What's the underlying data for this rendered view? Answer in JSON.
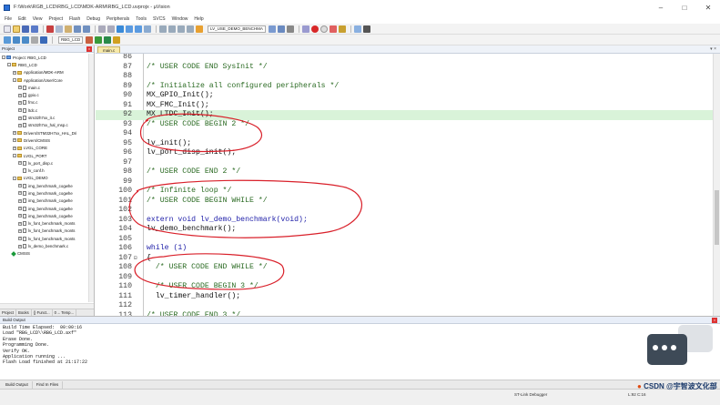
{
  "window": {
    "title": "F:\\Work\\RGB_LCD\\RBG_LCD\\MDK-ARM\\RBG_LCD.uvprojx - µVision",
    "controls": [
      "–",
      "□",
      "✕"
    ]
  },
  "menu": [
    "File",
    "Edit",
    "View",
    "Project",
    "Flash",
    "Debug",
    "Peripherals",
    "Tools",
    "SVCS",
    "Window",
    "Help"
  ],
  "toolbar": {
    "find_text": "LV_USE_DEMO_BENCHMA",
    "target_name": "RBG_LCD"
  },
  "project_panel": {
    "title": "Project",
    "tree": [
      {
        "label": "Project: RBG_LCD",
        "level": 0,
        "type": "proj",
        "exp": "-"
      },
      {
        "label": "RBG_LCD",
        "level": 1,
        "type": "folder",
        "exp": "-"
      },
      {
        "label": "Application/MDK-ARM",
        "level": 2,
        "type": "folder",
        "exp": "+"
      },
      {
        "label": "Application/User/Core",
        "level": 2,
        "type": "folder",
        "exp": "-"
      },
      {
        "label": "main.c",
        "level": 3,
        "type": "file",
        "exp": "+"
      },
      {
        "label": "gpio.c",
        "level": 3,
        "type": "file",
        "exp": "+"
      },
      {
        "label": "fmc.c",
        "level": 3,
        "type": "file",
        "exp": "+"
      },
      {
        "label": "ltdc.c",
        "level": 3,
        "type": "file",
        "exp": "+"
      },
      {
        "label": "stm32h7xx_it.c",
        "level": 3,
        "type": "file",
        "exp": "+"
      },
      {
        "label": "stm32h7xx_hal_msp.c",
        "level": 3,
        "type": "file",
        "exp": "+"
      },
      {
        "label": "Drivers/STM32H7xx_HAL_Dri",
        "level": 2,
        "type": "folder",
        "exp": "+"
      },
      {
        "label": "Drivers/CMSIS",
        "level": 2,
        "type": "folder",
        "exp": "+"
      },
      {
        "label": "LVGL_CORE",
        "level": 2,
        "type": "folder",
        "exp": "+"
      },
      {
        "label": "LVGL_PORT",
        "level": 2,
        "type": "folder",
        "exp": "-"
      },
      {
        "label": "lv_port_disp.c",
        "level": 3,
        "type": "file",
        "exp": "+"
      },
      {
        "label": "lv_conf.h",
        "level": 3,
        "type": "file",
        "exp": ""
      },
      {
        "label": "LVGL_DEMO",
        "level": 2,
        "type": "folder",
        "exp": "-"
      },
      {
        "label": "img_benchmark_cogwhe",
        "level": 3,
        "type": "file",
        "exp": "+"
      },
      {
        "label": "img_benchmark_cogwhe",
        "level": 3,
        "type": "file",
        "exp": "+"
      },
      {
        "label": "img_benchmark_cogwhe",
        "level": 3,
        "type": "file",
        "exp": "+"
      },
      {
        "label": "img_benchmark_cogwhe",
        "level": 3,
        "type": "file",
        "exp": "+"
      },
      {
        "label": "img_benchmark_cogwhe",
        "level": 3,
        "type": "file",
        "exp": "+"
      },
      {
        "label": "lv_font_benchmark_monts",
        "level": 3,
        "type": "file",
        "exp": "+"
      },
      {
        "label": "lv_font_benchmark_monts",
        "level": 3,
        "type": "file",
        "exp": "+"
      },
      {
        "label": "lv_font_benchmark_monts",
        "level": 3,
        "type": "file",
        "exp": "+"
      },
      {
        "label": "lv_demo_benchmark.c",
        "level": 3,
        "type": "file",
        "exp": "+"
      },
      {
        "label": "CMSIS",
        "level": 1,
        "type": "gem",
        "exp": ""
      }
    ],
    "tabs": [
      "Project",
      "Books",
      "{} Funct...",
      "0→ Temp..."
    ]
  },
  "editor": {
    "tab": "main.c",
    "lines": [
      {
        "n": "86",
        "fold": "",
        "text": "",
        "style": "plain"
      },
      {
        "n": "87",
        "fold": "",
        "text": "/* USER CODE END SysInit */",
        "style": "comment"
      },
      {
        "n": "88",
        "fold": "",
        "text": "",
        "style": "plain"
      },
      {
        "n": "89",
        "fold": "",
        "text": "/* Initialize all configured peripherals */",
        "style": "comment"
      },
      {
        "n": "90",
        "fold": "",
        "text": "MX_GPIO_Init();",
        "style": "plain"
      },
      {
        "n": "91",
        "fold": "",
        "text": "MX_FMC_Init();",
        "style": "plain"
      },
      {
        "n": "92",
        "fold": "",
        "text": "MX_LTDC_Init();",
        "style": "plain",
        "highlight": true
      },
      {
        "n": "93",
        "fold": "",
        "text": "/* USER CODE BEGIN 2 */",
        "style": "comment"
      },
      {
        "n": "94",
        "fold": "",
        "text": "",
        "style": "plain"
      },
      {
        "n": "95",
        "fold": "",
        "text": "lv_init();",
        "style": "plain"
      },
      {
        "n": "96",
        "fold": "",
        "text": "lv_port_disp_init();",
        "style": "plain"
      },
      {
        "n": "97",
        "fold": "",
        "text": "",
        "style": "plain"
      },
      {
        "n": "98",
        "fold": "",
        "text": "/* USER CODE END 2 */",
        "style": "comment"
      },
      {
        "n": "99",
        "fold": "",
        "text": "",
        "style": "plain"
      },
      {
        "n": "100",
        "fold": "",
        "text": "/* Infinite loop */",
        "style": "comment"
      },
      {
        "n": "101",
        "fold": "",
        "text": "/* USER CODE BEGIN WHILE */",
        "style": "comment"
      },
      {
        "n": "102",
        "fold": "",
        "text": "",
        "style": "plain"
      },
      {
        "n": "103",
        "fold": "",
        "text": "extern void lv_demo_benchmark(void);",
        "style": "keyword"
      },
      {
        "n": "104",
        "fold": "",
        "text": "lv_demo_benchmark();",
        "style": "plain"
      },
      {
        "n": "105",
        "fold": "",
        "text": "",
        "style": "plain"
      },
      {
        "n": "106",
        "fold": "",
        "text": "while (1)",
        "style": "keyword"
      },
      {
        "n": "107",
        "fold": "⊟",
        "text": "{",
        "style": "plain"
      },
      {
        "n": "108",
        "fold": "",
        "text": "  /* USER CODE END WHILE */",
        "style": "comment"
      },
      {
        "n": "109",
        "fold": "",
        "text": "",
        "style": "plain"
      },
      {
        "n": "110",
        "fold": "",
        "text": "  /* USER CODE BEGIN 3 */",
        "style": "comment"
      },
      {
        "n": "111",
        "fold": "",
        "text": "  lv_timer_handler();",
        "style": "plain"
      },
      {
        "n": "112",
        "fold": "",
        "text": "",
        "style": "plain"
      },
      {
        "n": "113",
        "fold": "",
        "text": "/* USER CODE END 3 */",
        "style": "comment"
      },
      {
        "n": "114",
        "fold": "",
        "text": "}",
        "style": "plain"
      },
      {
        "n": "115",
        "fold": "",
        "text": "",
        "style": "plain"
      }
    ]
  },
  "build_output": {
    "title": "Build Output",
    "lines": [
      "Build Time Elapsed:  00:00:16",
      "Load \"RBG_LCD\\\\RBG_LCD.axf\"",
      "Erase Done.",
      "Programming Done.",
      "Verify OK.",
      "Application running ...",
      "Flash Load finished at 21:17:22"
    ]
  },
  "bottom_tabs": [
    "Build Output",
    "Find In Files"
  ],
  "status": {
    "debugger": "ST-Link Debugger",
    "position": "L:92 C:16"
  },
  "watermark": "CSDN @宇智波文化部",
  "annotation_color": "#d9202a"
}
